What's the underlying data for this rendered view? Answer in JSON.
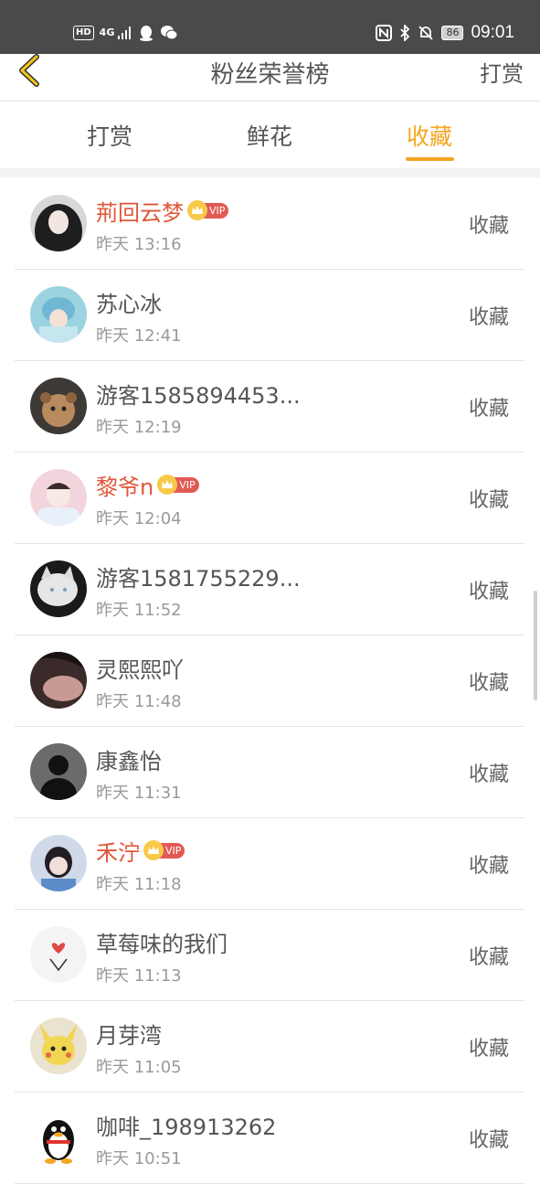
{
  "status_bar": {
    "left_badge": "HD",
    "signal": "4G",
    "battery": "86",
    "time": "09:01"
  },
  "nav": {
    "title": "粉丝荣誉榜",
    "right_action": "打赏"
  },
  "tabs": [
    {
      "label": "打赏",
      "active": false
    },
    {
      "label": "鲜花",
      "active": false
    },
    {
      "label": "收藏",
      "active": true
    }
  ],
  "vip_label": "VIP",
  "fans": [
    {
      "name": "荊回云梦",
      "vip": true,
      "time": "昨天 13:16",
      "action": "收藏",
      "avatar": "dark-haired-girl"
    },
    {
      "name": "苏心冰",
      "vip": false,
      "time": "昨天 12:41",
      "action": "收藏",
      "avatar": "blue-cap"
    },
    {
      "name": "游客1585894453...",
      "vip": false,
      "time": "昨天 12:19",
      "action": "收藏",
      "avatar": "bear-face"
    },
    {
      "name": "黎爷n",
      "vip": true,
      "time": "昨天 12:04",
      "action": "收藏",
      "avatar": "girl-white-hoodie"
    },
    {
      "name": "游客1581755229...",
      "vip": false,
      "time": "昨天 11:52",
      "action": "收藏",
      "avatar": "white-cat"
    },
    {
      "name": "灵熙熙吖",
      "vip": false,
      "time": "昨天 11:48",
      "action": "收藏",
      "avatar": "dark-portrait"
    },
    {
      "name": "康鑫怡",
      "vip": false,
      "time": "昨天 11:31",
      "action": "收藏",
      "avatar": "silhouette"
    },
    {
      "name": "禾泞",
      "vip": true,
      "time": "昨天 11:18",
      "action": "收藏",
      "avatar": "girl-bangs"
    },
    {
      "name": "草莓味的我们",
      "vip": false,
      "time": "昨天 11:13",
      "action": "收藏",
      "avatar": "hands-heart"
    },
    {
      "name": "月芽湾",
      "vip": false,
      "time": "昨天 11:05",
      "action": "收藏",
      "avatar": "pikachu"
    },
    {
      "name": "咖啡_198913262",
      "vip": false,
      "time": "昨天 10:51",
      "action": "收藏",
      "avatar": "qq-penguin"
    }
  ]
}
